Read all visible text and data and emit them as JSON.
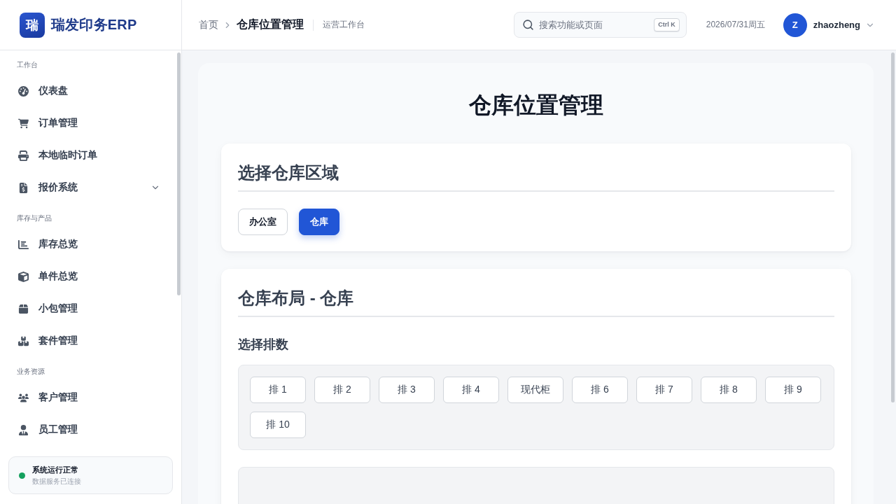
{
  "brand": {
    "logo_char": "瑞",
    "name": "瑞发印务ERP"
  },
  "sidebar": {
    "sections": [
      {
        "label": "工作台",
        "items": [
          {
            "label": "仪表盘",
            "submenu": false
          },
          {
            "label": "订单管理",
            "submenu": false
          },
          {
            "label": "本地临时订单",
            "submenu": false
          },
          {
            "label": "报价系统",
            "submenu": true
          }
        ]
      },
      {
        "label": "库存与产品",
        "items": [
          {
            "label": "库存总览",
            "submenu": false
          },
          {
            "label": "单件总览",
            "submenu": false
          },
          {
            "label": "小包管理",
            "submenu": false
          },
          {
            "label": "套件管理",
            "submenu": false
          }
        ]
      },
      {
        "label": "业务资源",
        "items": [
          {
            "label": "客户管理",
            "submenu": false
          },
          {
            "label": "员工管理",
            "submenu": false
          }
        ]
      }
    ],
    "status": {
      "online": true,
      "title": "系统运行正常",
      "subtitle": "数据服务已连接"
    }
  },
  "header": {
    "breadcrumb": {
      "home": "首页",
      "current": "仓库位置管理"
    },
    "workspace": "运营工作台",
    "search": {
      "placeholder": "搜索功能或页面",
      "shortcut": "Ctrl K"
    },
    "date": "2026/07/31周五",
    "user": {
      "initial": "Z",
      "name": "zhaozheng"
    }
  },
  "page": {
    "title": "仓库位置管理",
    "area_card": {
      "heading": "选择仓库区域",
      "areas": [
        {
          "label": "办公室",
          "selected": false
        },
        {
          "label": "仓库",
          "selected": true
        }
      ]
    },
    "layout_card": {
      "heading": "仓库布局 - 仓库",
      "rows_heading": "选择排数",
      "rows": [
        {
          "label": "排 1",
          "selected": false
        },
        {
          "label": "排 2",
          "selected": false
        },
        {
          "label": "排 3",
          "selected": false
        },
        {
          "label": "排 4",
          "selected": false
        },
        {
          "label": "现代柜",
          "selected": false
        },
        {
          "label": "排 6",
          "selected": false
        },
        {
          "label": "排 7",
          "selected": false
        },
        {
          "label": "排 8",
          "selected": false
        },
        {
          "label": "排 9",
          "selected": false
        },
        {
          "label": "排 10",
          "selected": false
        }
      ]
    }
  }
}
